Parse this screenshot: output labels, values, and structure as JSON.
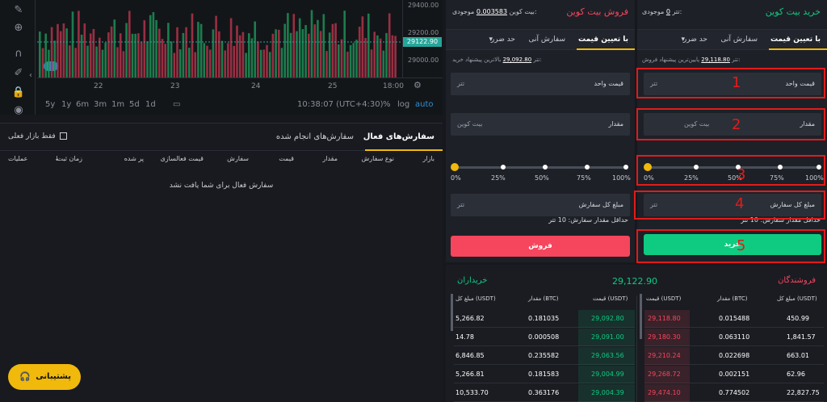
{
  "chart": {
    "price_ticks": [
      "29400.00",
      "29200.00",
      "29000.00"
    ],
    "current_price_tag": "29122.90",
    "date_ticks": [
      "22",
      "23",
      "24",
      "25",
      "18:00"
    ],
    "ranges": [
      "5y",
      "1y",
      "6m",
      "3m",
      "1m",
      "5d",
      "1d"
    ],
    "clock": "10:38:07 (UTC+4:30)",
    "scale_options": [
      "%",
      "log",
      "auto"
    ]
  },
  "orders_panel": {
    "tab_active": "سفارش‌های فعال",
    "tab_done": "سفارش‌های انجام شده",
    "filter_label": "فقط بازار فعلی",
    "columns": [
      "بازار",
      "نوع سفارش",
      "مقدار",
      "قیمت",
      "سفارش",
      "قیمت فعالسازی",
      "پر شده",
      "زمان ثبت",
      "عملیات"
    ],
    "empty_message": "سفارش فعال برای شما یافت نشد"
  },
  "support_label": "پشتیبانی",
  "buy_panel": {
    "title": "خرید بیت کوین",
    "balance_label": "موجودی:",
    "balance_value": "0",
    "balance_unit": "تتر",
    "tabs": [
      "با تعیین قیمت",
      "سفارش آنی",
      "حد ضرر"
    ],
    "best_label": "پایین‌ترین پیشنهاد فروش:",
    "best_value": "29,118.80",
    "best_unit": "تتر",
    "price_label": "قیمت واحد",
    "price_unit": "تتر",
    "amount_label": "مقدار",
    "amount_unit": "بیت کوین",
    "percents": [
      "0%",
      "25%",
      "50%",
      "75%",
      "100%"
    ],
    "total_label": "مبلغ کل سفارش",
    "total_unit": "تتر",
    "min_order": "حداقل مقدار سفارش: 10 تتر",
    "button": "خرید",
    "color": "#0ecb81"
  },
  "sell_panel": {
    "title": "فروش بیت کوین",
    "balance_label": "موجودی:",
    "balance_value": "0.003583",
    "balance_unit": "بیت کوین",
    "tabs": [
      "با تعیین قیمت",
      "سفارش آنی",
      "حد ضرر"
    ],
    "best_label": "بالاترین پیشنهاد خرید:",
    "best_value": "29,092.80",
    "best_unit": "تتر",
    "price_label": "قیمت واحد",
    "price_unit": "تتر",
    "amount_label": "مقدار",
    "amount_unit": "بیت کوین",
    "percents": [
      "0%",
      "25%",
      "50%",
      "75%",
      "100%"
    ],
    "total_label": "مبلغ کل سفارش",
    "total_unit": "تتر",
    "min_order": "حداقل مقدار سفارش: 10 تتر",
    "button": "فروش",
    "color": "#f6465d"
  },
  "annotations": [
    "1",
    "2",
    "3",
    "4",
    "5"
  ],
  "orderbook": {
    "mid_price": "29,122.90",
    "sellers_title": "فروشندگان",
    "buyers_title": "خریداران",
    "col_total": "مبلغ کل (USDT)",
    "col_amount": "مقدار (BTC)",
    "col_price": "قیمت (USDT)",
    "sellers": [
      {
        "total": "450.99",
        "amount": "0.015488",
        "price": "29,118.80"
      },
      {
        "total": "1,841.57",
        "amount": "0.063110",
        "price": "29,180.30"
      },
      {
        "total": "663.01",
        "amount": "0.022698",
        "price": "29,210.24"
      },
      {
        "total": "62.96",
        "amount": "0.002151",
        "price": "29,268.72"
      },
      {
        "total": "22,827.75",
        "amount": "0.774502",
        "price": "29,474.10"
      }
    ],
    "buyers": [
      {
        "total": "5,266.82",
        "amount": "0.181035",
        "price": "29,092.80"
      },
      {
        "total": "14.78",
        "amount": "0.000508",
        "price": "29,091.00"
      },
      {
        "total": "6,846.85",
        "amount": "0.235582",
        "price": "29,063.56"
      },
      {
        "total": "5,266.81",
        "amount": "0.181583",
        "price": "29,004.99"
      },
      {
        "total": "10,533.70",
        "amount": "0.363176",
        "price": "29,004.39"
      }
    ]
  }
}
